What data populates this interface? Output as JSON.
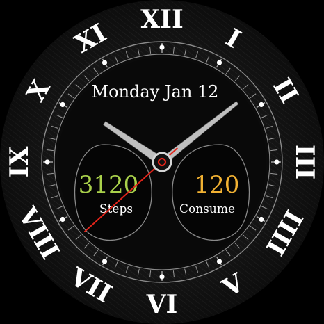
{
  "watchface": {
    "date_text": "Monday Jan 12",
    "numerals": [
      "I",
      "II",
      "III",
      "IIII",
      "V",
      "VI",
      "VII",
      "VIII",
      "IX",
      "X",
      "XI",
      "XII"
    ],
    "highlight_numeral": "X",
    "left_complication": {
      "value": "3120",
      "label": "Steps",
      "value_color": "#a9d14b"
    },
    "right_complication": {
      "value": "120",
      "label": "Consume",
      "value_color": "#f2b233"
    },
    "time": {
      "hour": 10,
      "minute": 8,
      "second": 38
    },
    "colors": {
      "background": "#0e0e0e",
      "numeral": "#ffffff",
      "highlight": "#e2241a",
      "hand": "#bfbfbf",
      "second_hand": "#e2241a"
    },
    "icons": {
      "hour_hand": "hour-hand",
      "minute_hand": "minute-hand",
      "second_hand": "second-hand"
    }
  }
}
